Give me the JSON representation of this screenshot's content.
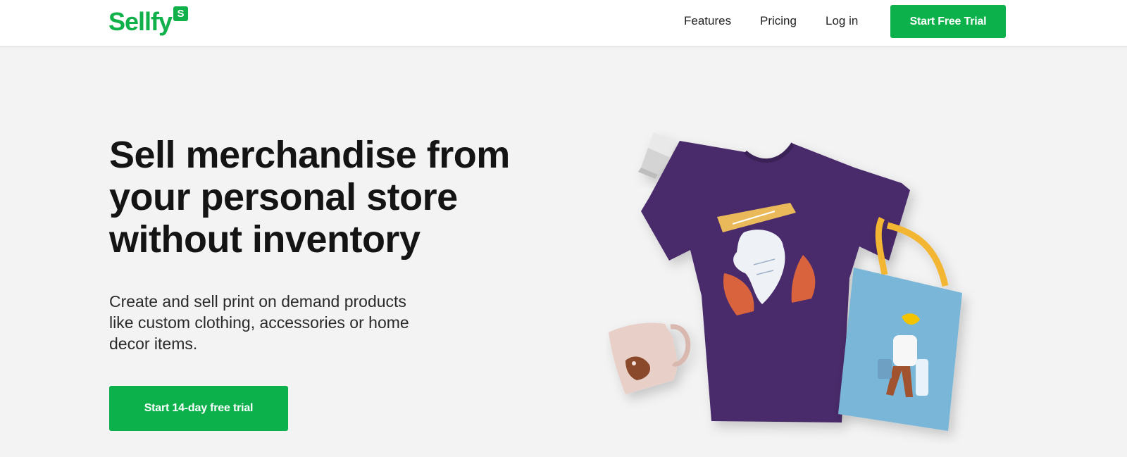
{
  "header": {
    "logo": {
      "text": "Sellfy",
      "badge": "S"
    },
    "nav": [
      {
        "label": "Features"
      },
      {
        "label": "Pricing"
      },
      {
        "label": "Log in"
      }
    ],
    "cta_label": "Start Free Trial"
  },
  "hero": {
    "title_lines": [
      "Sell merchandise from",
      "your personal store",
      "without inventory"
    ],
    "subtitle_lines": [
      "Create and sell print on demand products",
      "like custom clothing, accessories or home",
      "decor items."
    ],
    "cta_label": "Start 14-day free trial"
  },
  "colors": {
    "brand_green": "#0cb14b",
    "page_background": "#f3f3f3",
    "tshirt_purple": "#4a2a6b",
    "tote_blue": "#79b6d8",
    "mug_pink": "#e8cfc8",
    "tote_handle_yellow": "#f2b632"
  },
  "icons": [
    "sellfy-logo",
    "tshirt-illustration",
    "mug-illustration",
    "tote-bag-illustration",
    "phone-stand-illustration"
  ]
}
